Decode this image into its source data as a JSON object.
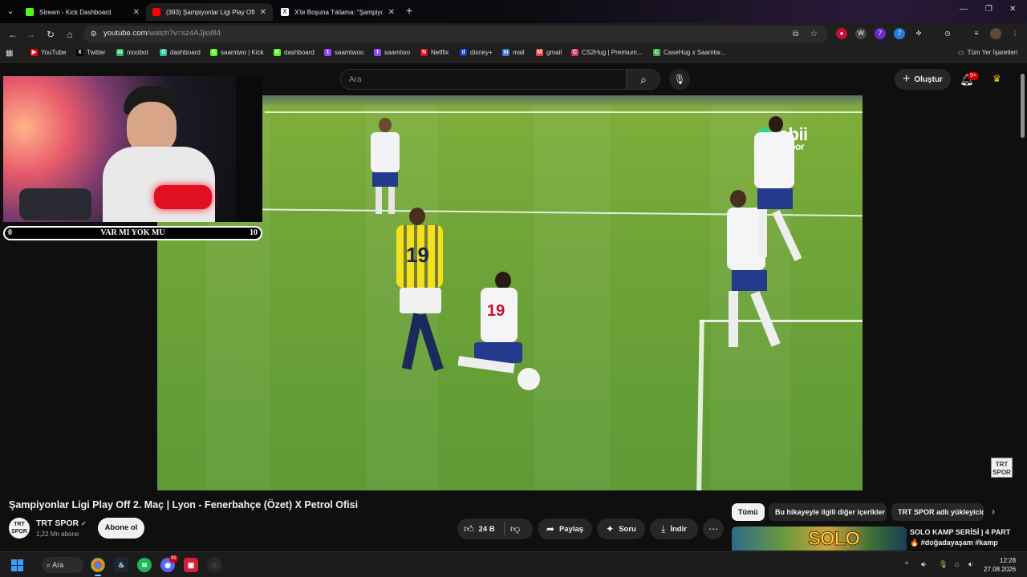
{
  "browser": {
    "tabs": [
      {
        "title": "Stream - Kick Dashboard",
        "color": "#53fc18"
      },
      {
        "title": "(393) Şampiyonlar Ligi Play Off",
        "color": "#ff0000"
      },
      {
        "title": "X'te Boşuna Tıklama: \"Şampiyo",
        "color": "#ffffff"
      }
    ],
    "url_host": "youtube.com",
    "url_path": "/watch?v=sz4AJjioI84"
  },
  "bookmarks": [
    {
      "label": "YouTube",
      "icon": "youtube-icon",
      "color": "#ff0000",
      "glyph": "▶"
    },
    {
      "label": "Twitter",
      "icon": "x-icon",
      "color": "#000000",
      "glyph": "X"
    },
    {
      "label": "moobot",
      "icon": "moobot-icon",
      "color": "#30b566",
      "glyph": "m"
    },
    {
      "label": "dashboard",
      "icon": "dashboard-icon",
      "color": "#27c2a0",
      "glyph": "d"
    },
    {
      "label": "saamtwo | Kick",
      "icon": "kick-icon",
      "color": "#53fc18",
      "glyph": "K"
    },
    {
      "label": "dashboard",
      "icon": "kick-icon",
      "color": "#53fc18",
      "glyph": "K"
    },
    {
      "label": "saamtwoo",
      "icon": "twitch-icon",
      "color": "#9146ff",
      "glyph": "t"
    },
    {
      "label": "saamtwo",
      "icon": "twitch-icon",
      "color": "#9146ff",
      "glyph": "t"
    },
    {
      "label": "Netflix",
      "icon": "netflix-icon",
      "color": "#e50914",
      "glyph": "N"
    },
    {
      "label": "disney+",
      "icon": "disney-icon",
      "color": "#113ccf",
      "glyph": "d"
    },
    {
      "label": "mail",
      "icon": "mail-icon",
      "color": "#3a7bd5",
      "glyph": "m"
    },
    {
      "label": "gmail",
      "icon": "gmail-icon",
      "color": "#ea4335",
      "glyph": "M"
    },
    {
      "label": "CS2Hug | Premium...",
      "icon": "cs2hug-icon",
      "color": "#d23b5a",
      "glyph": "C"
    },
    {
      "label": "CaseHug x Saamtw...",
      "icon": "casehug-icon",
      "color": "#3cb44b",
      "glyph": "C"
    }
  ],
  "bookmarks_all": "Tüm Yer İşaretleri",
  "youtube": {
    "search_placeholder": "Ara",
    "create_label": "Oluştur",
    "notif_count": "9+",
    "video_title": "Şampiyonlar Ligi Play Off 2. Maç | Lyon - Fenerbahçe (Özet) X Petrol Ofisi",
    "channel_name": "TRT SPOR",
    "channel_subs": "1,22 Mn abone",
    "channel_avatar_text": "TRT SPOR",
    "subscribe_label": "Abone ol",
    "like_count": "24 B",
    "share_label": "Paylaş",
    "ask_label": "Soru",
    "download_label": "İndir",
    "chips": [
      "Tümü",
      "Bu hikayeyle ilgili diğer içerikler",
      "TRT SPOR adlı yükleyicid"
    ],
    "rec_title": "SOLO KAMP SERİSİ | 4 PART 🔥 #doğadayaşam #kamp",
    "rec_thumb_text": "SOLO KAMP",
    "watermark_text": "TRT SPOR"
  },
  "video_overlay": {
    "brand": "tabii",
    "brand_sub": "spor",
    "jersey_yellow": "19",
    "jersey_white": "19"
  },
  "stream_overlay": {
    "left_score": "0",
    "label": "VAR MI YOK MU",
    "right_score": "10"
  },
  "taskbar": {
    "search_label": "Ara",
    "time": "12:28",
    "date": "27.08.2026",
    "discord_badge": "99"
  }
}
